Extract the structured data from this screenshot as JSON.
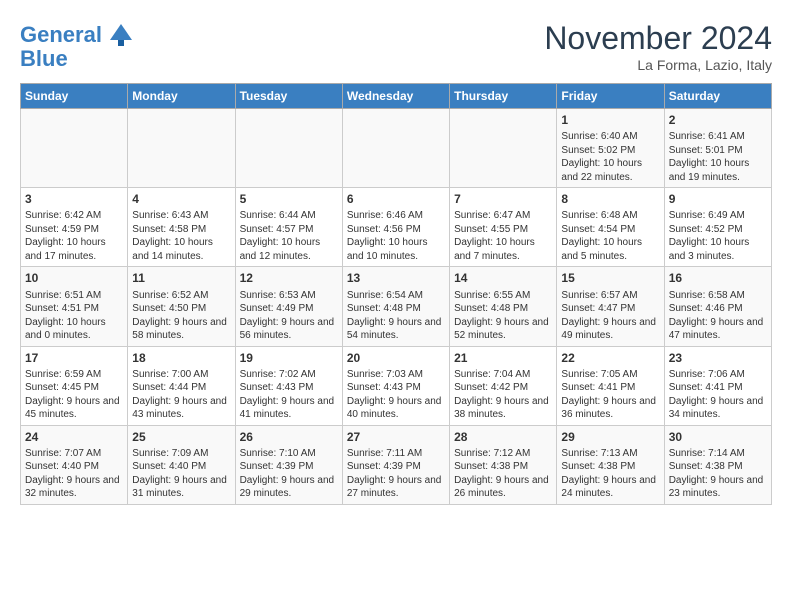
{
  "header": {
    "logo_line1": "General",
    "logo_line2": "Blue",
    "title": "November 2024",
    "subtitle": "La Forma, Lazio, Italy"
  },
  "columns": [
    "Sunday",
    "Monday",
    "Tuesday",
    "Wednesday",
    "Thursday",
    "Friday",
    "Saturday"
  ],
  "weeks": [
    [
      {
        "day": "",
        "info": ""
      },
      {
        "day": "",
        "info": ""
      },
      {
        "day": "",
        "info": ""
      },
      {
        "day": "",
        "info": ""
      },
      {
        "day": "",
        "info": ""
      },
      {
        "day": "1",
        "info": "Sunrise: 6:40 AM\nSunset: 5:02 PM\nDaylight: 10 hours and 22 minutes."
      },
      {
        "day": "2",
        "info": "Sunrise: 6:41 AM\nSunset: 5:01 PM\nDaylight: 10 hours and 19 minutes."
      }
    ],
    [
      {
        "day": "3",
        "info": "Sunrise: 6:42 AM\nSunset: 4:59 PM\nDaylight: 10 hours and 17 minutes."
      },
      {
        "day": "4",
        "info": "Sunrise: 6:43 AM\nSunset: 4:58 PM\nDaylight: 10 hours and 14 minutes."
      },
      {
        "day": "5",
        "info": "Sunrise: 6:44 AM\nSunset: 4:57 PM\nDaylight: 10 hours and 12 minutes."
      },
      {
        "day": "6",
        "info": "Sunrise: 6:46 AM\nSunset: 4:56 PM\nDaylight: 10 hours and 10 minutes."
      },
      {
        "day": "7",
        "info": "Sunrise: 6:47 AM\nSunset: 4:55 PM\nDaylight: 10 hours and 7 minutes."
      },
      {
        "day": "8",
        "info": "Sunrise: 6:48 AM\nSunset: 4:54 PM\nDaylight: 10 hours and 5 minutes."
      },
      {
        "day": "9",
        "info": "Sunrise: 6:49 AM\nSunset: 4:52 PM\nDaylight: 10 hours and 3 minutes."
      }
    ],
    [
      {
        "day": "10",
        "info": "Sunrise: 6:51 AM\nSunset: 4:51 PM\nDaylight: 10 hours and 0 minutes."
      },
      {
        "day": "11",
        "info": "Sunrise: 6:52 AM\nSunset: 4:50 PM\nDaylight: 9 hours and 58 minutes."
      },
      {
        "day": "12",
        "info": "Sunrise: 6:53 AM\nSunset: 4:49 PM\nDaylight: 9 hours and 56 minutes."
      },
      {
        "day": "13",
        "info": "Sunrise: 6:54 AM\nSunset: 4:48 PM\nDaylight: 9 hours and 54 minutes."
      },
      {
        "day": "14",
        "info": "Sunrise: 6:55 AM\nSunset: 4:48 PM\nDaylight: 9 hours and 52 minutes."
      },
      {
        "day": "15",
        "info": "Sunrise: 6:57 AM\nSunset: 4:47 PM\nDaylight: 9 hours and 49 minutes."
      },
      {
        "day": "16",
        "info": "Sunrise: 6:58 AM\nSunset: 4:46 PM\nDaylight: 9 hours and 47 minutes."
      }
    ],
    [
      {
        "day": "17",
        "info": "Sunrise: 6:59 AM\nSunset: 4:45 PM\nDaylight: 9 hours and 45 minutes."
      },
      {
        "day": "18",
        "info": "Sunrise: 7:00 AM\nSunset: 4:44 PM\nDaylight: 9 hours and 43 minutes."
      },
      {
        "day": "19",
        "info": "Sunrise: 7:02 AM\nSunset: 4:43 PM\nDaylight: 9 hours and 41 minutes."
      },
      {
        "day": "20",
        "info": "Sunrise: 7:03 AM\nSunset: 4:43 PM\nDaylight: 9 hours and 40 minutes."
      },
      {
        "day": "21",
        "info": "Sunrise: 7:04 AM\nSunset: 4:42 PM\nDaylight: 9 hours and 38 minutes."
      },
      {
        "day": "22",
        "info": "Sunrise: 7:05 AM\nSunset: 4:41 PM\nDaylight: 9 hours and 36 minutes."
      },
      {
        "day": "23",
        "info": "Sunrise: 7:06 AM\nSunset: 4:41 PM\nDaylight: 9 hours and 34 minutes."
      }
    ],
    [
      {
        "day": "24",
        "info": "Sunrise: 7:07 AM\nSunset: 4:40 PM\nDaylight: 9 hours and 32 minutes."
      },
      {
        "day": "25",
        "info": "Sunrise: 7:09 AM\nSunset: 4:40 PM\nDaylight: 9 hours and 31 minutes."
      },
      {
        "day": "26",
        "info": "Sunrise: 7:10 AM\nSunset: 4:39 PM\nDaylight: 9 hours and 29 minutes."
      },
      {
        "day": "27",
        "info": "Sunrise: 7:11 AM\nSunset: 4:39 PM\nDaylight: 9 hours and 27 minutes."
      },
      {
        "day": "28",
        "info": "Sunrise: 7:12 AM\nSunset: 4:38 PM\nDaylight: 9 hours and 26 minutes."
      },
      {
        "day": "29",
        "info": "Sunrise: 7:13 AM\nSunset: 4:38 PM\nDaylight: 9 hours and 24 minutes."
      },
      {
        "day": "30",
        "info": "Sunrise: 7:14 AM\nSunset: 4:38 PM\nDaylight: 9 hours and 23 minutes."
      }
    ]
  ]
}
